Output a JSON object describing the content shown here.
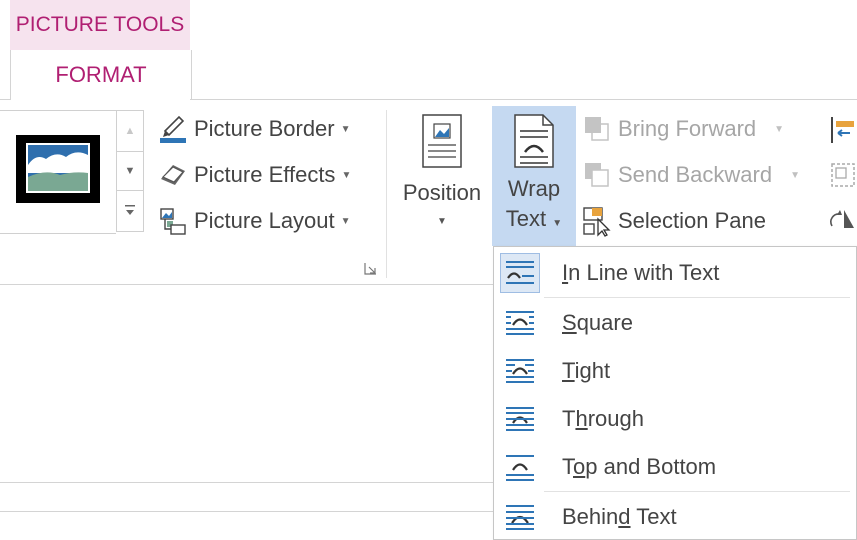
{
  "contextual_tab": {
    "group": "PICTURE TOOLS",
    "active_tab": "FORMAT"
  },
  "picture_styles": {
    "commands": [
      {
        "label": "Picture Border",
        "icon": "pen-border-icon",
        "enabled": true
      },
      {
        "label": "Picture Effects",
        "icon": "effects-icon",
        "enabled": true
      },
      {
        "label": "Picture Layout",
        "icon": "layout-icon",
        "enabled": true
      }
    ],
    "gallery_scroll": [
      "▲",
      "▼",
      "▼"
    ]
  },
  "arrange": {
    "position_label": "Position",
    "wrap_text_label": [
      "Wrap",
      "Text"
    ],
    "commands": [
      {
        "label": "Bring Forward",
        "icon": "bring-forward-icon",
        "enabled": false
      },
      {
        "label": "Send Backward",
        "icon": "send-backward-icon",
        "enabled": false
      },
      {
        "label": "Selection Pane",
        "icon": "selection-pane-icon",
        "enabled": true
      }
    ]
  },
  "wrap_menu": {
    "items": [
      {
        "label": "In Line with Text",
        "mnemonic_index": 0,
        "icon": "inline-text-icon",
        "highlighted": true
      },
      {
        "label": "Square",
        "mnemonic_index": 0,
        "icon": "square-wrap-icon",
        "highlighted": false
      },
      {
        "label": "Tight",
        "mnemonic_index": 0,
        "icon": "tight-wrap-icon",
        "highlighted": false
      },
      {
        "label": "Through",
        "mnemonic_index": 1,
        "icon": "through-wrap-icon",
        "highlighted": false
      },
      {
        "label": "Top and Bottom",
        "mnemonic_index": 1,
        "icon": "top-bottom-wrap-icon",
        "highlighted": false
      },
      {
        "label": "Behind Text",
        "mnemonic_index": 5,
        "icon": "behind-text-icon",
        "highlighted": false
      }
    ]
  },
  "colors": {
    "accent": "#b01f72",
    "selected": "#c5d9f1",
    "icon_blue": "#2e75b6"
  }
}
